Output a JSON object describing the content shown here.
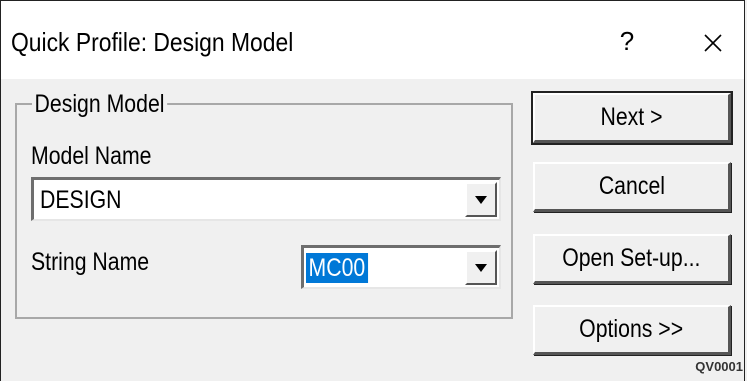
{
  "window": {
    "title": "Quick Profile: Design Model",
    "help_label": "?",
    "close_icon": "close-icon"
  },
  "group": {
    "legend": "Design Model",
    "model_name_label": "Model Name",
    "model_name_value": "DESIGN",
    "string_name_label": "String Name",
    "string_name_value": "MC00"
  },
  "buttons": {
    "next": "Next >",
    "cancel": "Cancel",
    "open_setup": "Open Set-up...",
    "options": "Options >>"
  },
  "footnote": "QV0001",
  "colors": {
    "background": "#f0f0f0",
    "titlebar": "#ffffff",
    "selection": "#0078d7"
  }
}
